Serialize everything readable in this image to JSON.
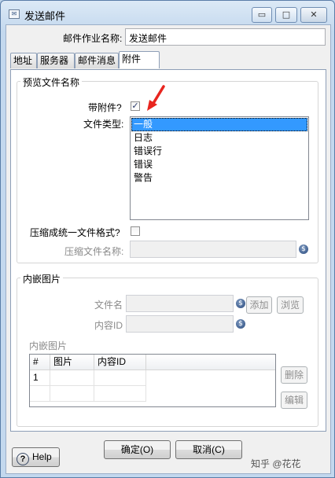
{
  "window": {
    "title": "发送邮件",
    "icon": "mail-icon",
    "controls": {
      "minimize": "▭",
      "maximize": "□",
      "close": "✕"
    }
  },
  "job": {
    "label": "邮件作业名称:",
    "value": "发送邮件"
  },
  "tabs": [
    {
      "label": "地址",
      "active": false
    },
    {
      "label": "服务器",
      "active": false
    },
    {
      "label": "邮件消息",
      "active": false
    },
    {
      "label": "附件",
      "active": true
    }
  ],
  "preview": {
    "group_title": "预览文件名称",
    "with_attachment_label": "带附件?",
    "with_attachment_checked": true,
    "check_mark": "✓",
    "file_type_label": "文件类型:",
    "file_types": [
      "一般",
      "日志",
      "错误行",
      "错误",
      "警告"
    ],
    "selected_file_type": "一般",
    "compress_label": "压缩成统一文件格式?",
    "compress_checked": false,
    "zip_name_label": "压缩文件名称:",
    "zip_name_value": ""
  },
  "embedded": {
    "group_title": "内嵌图片",
    "filename_label": "文件名",
    "filename_value": "",
    "content_id_label": "内容ID",
    "content_id_value": "",
    "add_button": "添加",
    "browse_button": "浏览",
    "grid_label": "内嵌图片",
    "grid_columns": [
      "#",
      "图片",
      "内容ID"
    ],
    "grid_rows": [
      [
        "1",
        "",
        ""
      ]
    ],
    "delete_button": "删除",
    "edit_button": "编辑"
  },
  "variable_icon": "$",
  "footer": {
    "help_button": "Help",
    "help_icon": "?",
    "ok_button": "确定(O)",
    "cancel_button": "取消(C)"
  },
  "watermark": "知乎 @花花",
  "colors": {
    "selection": "#3399ff",
    "annotation_arrow": "#e8251f",
    "window_frame": "#bcd3ea"
  }
}
